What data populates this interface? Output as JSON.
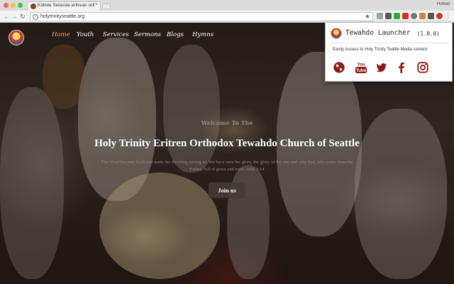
{
  "browser": {
    "tab_title": "Kidiste Selassie eritrean ortho",
    "tab_close": "×",
    "profile_name": "Hobeil",
    "url": "holytrinityseattle.org",
    "back_icon": "arrow-left-icon",
    "forward_icon": "arrow-right-icon",
    "reload_icon": "reload-icon"
  },
  "site": {
    "nav": [
      "Home",
      "Youth",
      "Services",
      "Sermons",
      "Blogs",
      "Hymns"
    ],
    "active_nav": "Home",
    "welcome": "Welcome To The",
    "headline": "Holy Trinity Eritren Orthodox Tewahdo Church of Seattle",
    "verse_line1": "The Word became flesh and made his dwelling among us. We have seen his glory, the glory of the one and only Son, who came from the",
    "verse_line2": "Father, full of grace and truth. John 3:14",
    "join_label": "Join us"
  },
  "extension_popup": {
    "title": "Tewahdo Launcher",
    "version": "(1.0.0)",
    "description": "Easily Access to Holy Trinity Teattle Media content",
    "icons": [
      "globe-icon",
      "youtube-icon",
      "twitter-icon",
      "facebook-icon",
      "instagram-icon"
    ],
    "youtube_text": "You Tube",
    "icon_color": "#8b1a12"
  },
  "colors": {
    "active_nav": "#e3a877",
    "accent_dark_red": "#8b1a12",
    "bookmark_star": "#3b78e7"
  }
}
